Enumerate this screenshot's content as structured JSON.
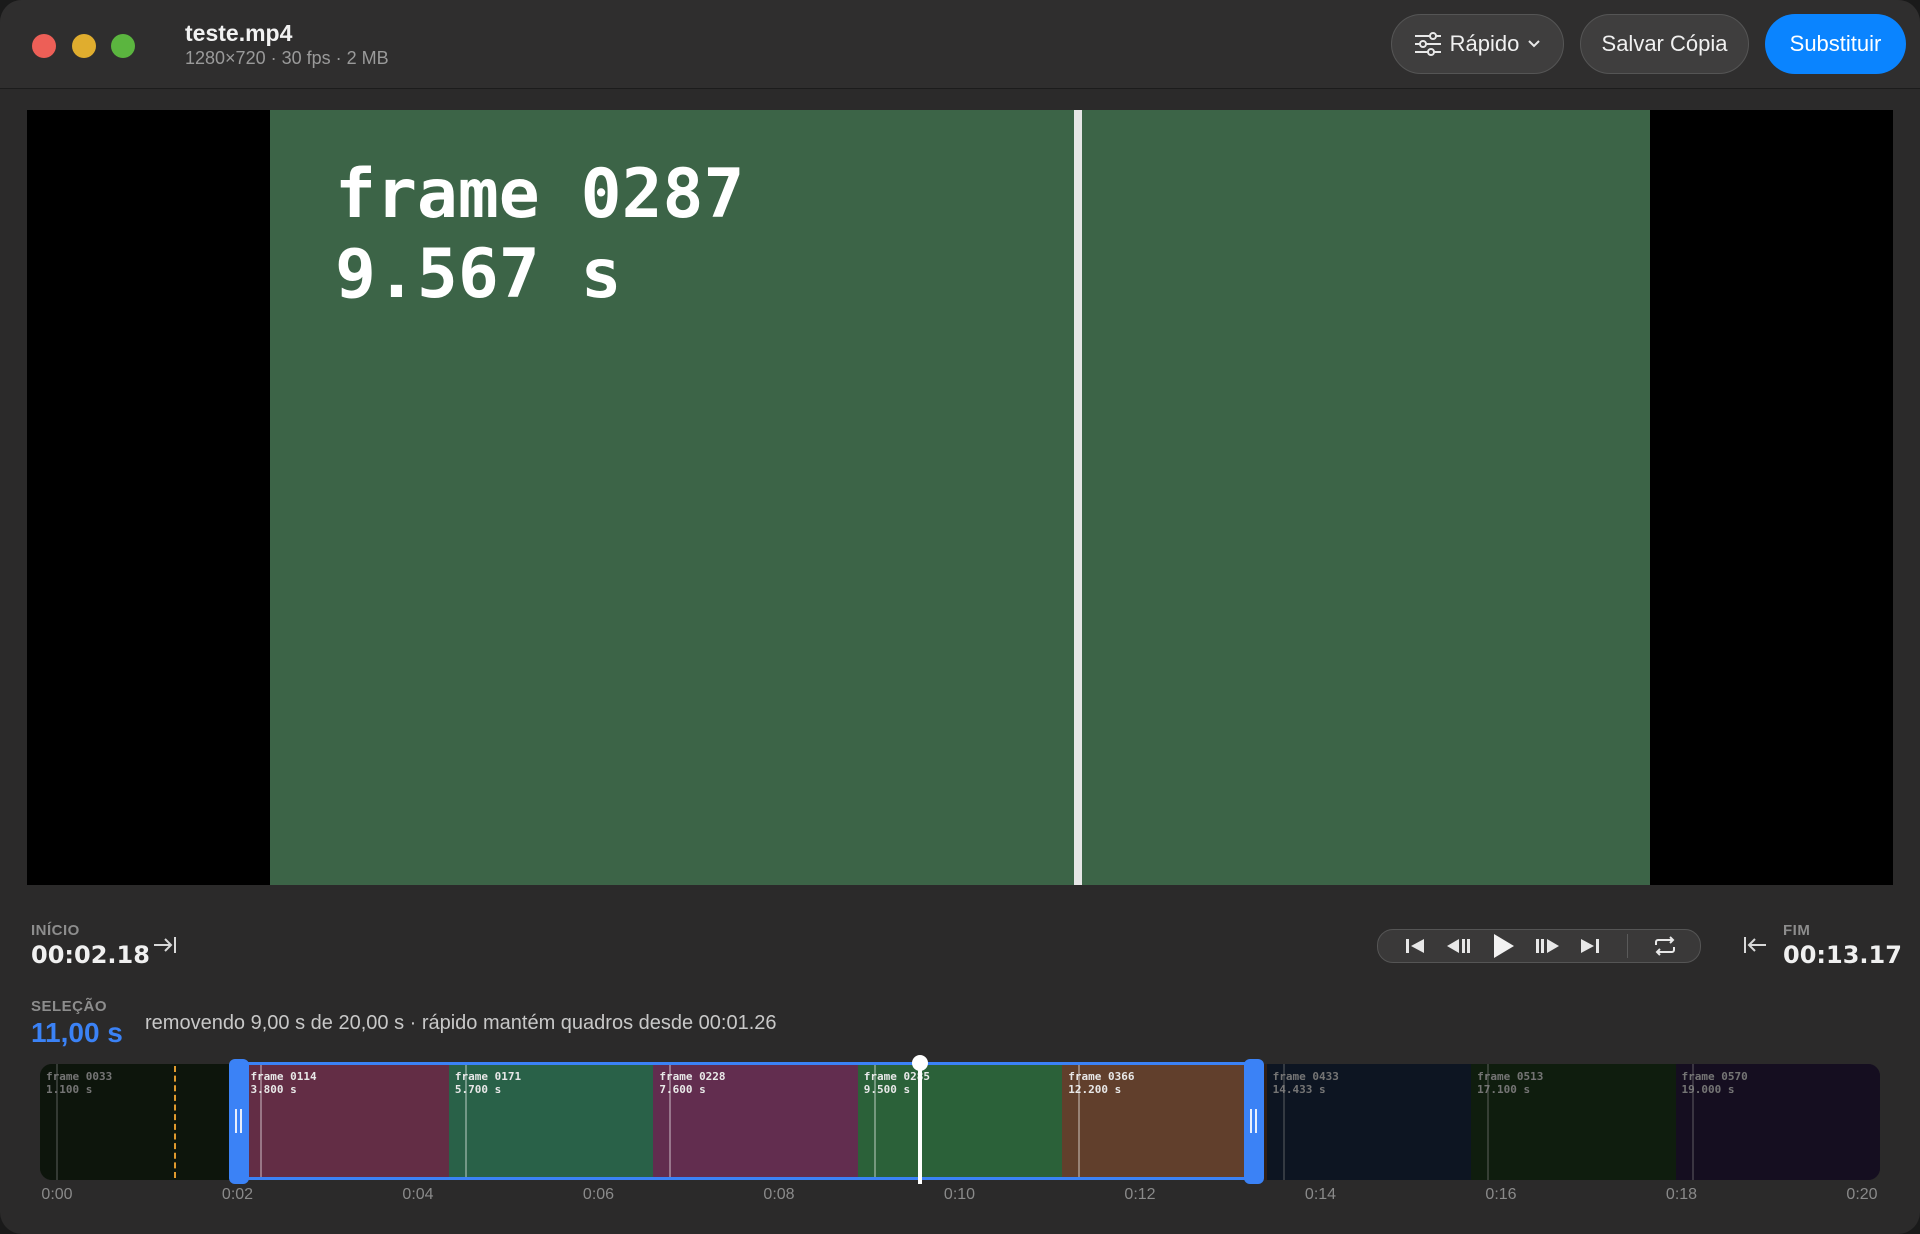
{
  "window": {
    "title": "teste.mp4",
    "meta": "1280×720 · 30 fps · 2 MB"
  },
  "toolbar": {
    "mode_label": "Rápido",
    "save_copy_label": "Salvar Cópia",
    "replace_label": "Substituir"
  },
  "preview": {
    "frame_line1": "frame 0287",
    "frame_line2": "9.567 s"
  },
  "controls": {
    "start_label": "INÍCIO",
    "start_time": "00:02.18",
    "end_label": "FIM",
    "end_time": "00:13.17",
    "selection_label": "SELEÇÃO",
    "selection_value": "11,00 s",
    "selection_desc": "removendo 9,00 s de 20,00 s · rápido mantém quadros desde 00:01.26"
  },
  "timeline": {
    "thumbnails": [
      {
        "label": "frame 0033\n1.100 s",
        "color": "#1a2a18"
      },
      {
        "label": "frame 0114\n3.800 s",
        "color": "#632d45"
      },
      {
        "label": "frame 0171\n5.700 s",
        "color": "#296148"
      },
      {
        "label": "frame 0228\n7.600 s",
        "color": "#622d4f"
      },
      {
        "label": "frame 0285\n9.500 s",
        "color": "#2b6139"
      },
      {
        "label": "frame 0366\n12.200 s",
        "color": "#613f2c"
      },
      {
        "label": "frame 0433\n14.433 s",
        "color": "#1a2a44"
      },
      {
        "label": "frame 0513\n17.100 s",
        "color": "#1f3a1c"
      },
      {
        "label": "frame 0570\n19.000 s",
        "color": "#2a1c40"
      }
    ],
    "axis": [
      "0:00",
      "0:02",
      "0:04",
      "0:06",
      "0:08",
      "0:10",
      "0:12",
      "0:14",
      "0:16",
      "0:18",
      "0:20"
    ],
    "total_seconds": 20,
    "selection_start_s": 2.18,
    "selection_end_s": 13.17,
    "playhead_s": 9.567
  },
  "colors": {
    "accent": "#0a84ff",
    "selection": "#3b82f6",
    "frame_bg": "#3c6447"
  }
}
